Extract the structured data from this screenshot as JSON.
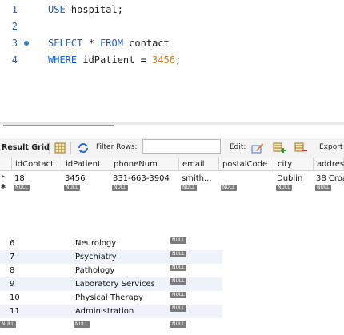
{
  "editor": {
    "lines": [
      {
        "no": "1",
        "parts": [
          {
            "t": "USE",
            "k": "kw"
          },
          {
            "t": " hospital;",
            "k": "tx"
          }
        ]
      },
      {
        "no": "2",
        "parts": []
      },
      {
        "no": "3",
        "parts": [
          {
            "t": "SELECT",
            "k": "kw"
          },
          {
            "t": " * ",
            "k": "tx"
          },
          {
            "t": "FROM",
            "k": "kw"
          },
          {
            "t": " contact",
            "k": "tx"
          }
        ],
        "breakpoint": true
      },
      {
        "no": "4",
        "parts": [
          {
            "t": "WHERE",
            "k": "kw"
          },
          {
            "t": " idPatient = ",
            "k": "tx"
          },
          {
            "t": "3456",
            "k": "num"
          },
          {
            "t": ";",
            "k": "tx"
          }
        ]
      }
    ]
  },
  "toolbar": {
    "result_grid": "Result Grid",
    "filter_rows": "Filter Rows:",
    "edit": "Edit:",
    "export": "Export"
  },
  "result": {
    "columns": [
      "idContact",
      "idPatient",
      "phoneNum",
      "email",
      "postalCode",
      "city",
      "address"
    ],
    "row": {
      "idContact": "18",
      "idPatient": "3456",
      "phoneNum": "331-663-3904",
      "email": "smith...",
      "postalCode": "",
      "city": "Dublin",
      "address": "38 Croa"
    },
    "null_label": "NULL"
  },
  "department_rows": [
    {
      "id": "6",
      "name": "Neurology"
    },
    {
      "id": "7",
      "name": "Psychiatry"
    },
    {
      "id": "8",
      "name": "Pathology"
    },
    {
      "id": "9",
      "name": "Laboratory Services"
    },
    {
      "id": "10",
      "name": "Physical Therapy"
    },
    {
      "id": "11",
      "name": "Administration"
    }
  ]
}
